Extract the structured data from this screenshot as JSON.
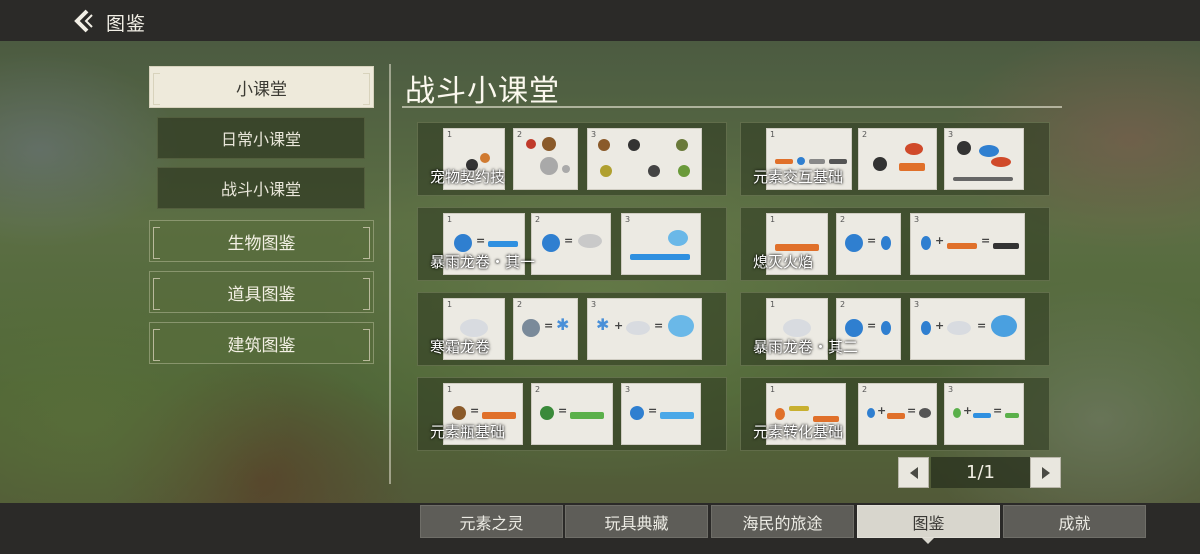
{
  "header": {
    "title": "图鉴"
  },
  "sidebar": {
    "items": [
      {
        "label": "小课堂"
      },
      {
        "label": "日常小课堂"
      },
      {
        "label": "战斗小课堂"
      },
      {
        "label": "生物图鉴"
      },
      {
        "label": "道具图鉴"
      },
      {
        "label": "建筑图鉴"
      }
    ]
  },
  "panel": {
    "title": "战斗小课堂",
    "cards": [
      {
        "label": "宠物契约技"
      },
      {
        "label": "元素交互基础"
      },
      {
        "label": "暴雨龙卷・其一"
      },
      {
        "label": "熄灭火焰"
      },
      {
        "label": "寒霜龙卷"
      },
      {
        "label": "暴雨龙卷・其二"
      },
      {
        "label": "元素瓶基础"
      },
      {
        "label": "元素转化基础"
      }
    ]
  },
  "pagination": {
    "text": "1/1"
  },
  "tabs": [
    {
      "label": "元素之灵"
    },
    {
      "label": "玩具典藏"
    },
    {
      "label": "海民的旅途"
    },
    {
      "label": "图鉴"
    },
    {
      "label": "成就"
    }
  ],
  "colors": {
    "panel_bg": "#324024",
    "active_tab": "#d8d6cd",
    "topbar": "#2b2a28",
    "water_blue": "#2f7fd0",
    "fire_orange": "#e0702a"
  }
}
